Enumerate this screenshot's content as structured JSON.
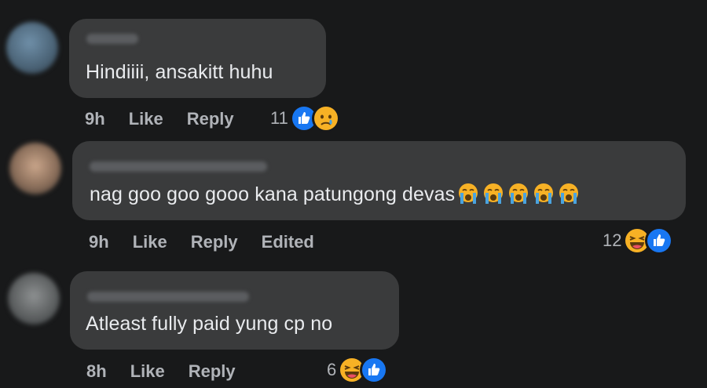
{
  "comments": [
    {
      "author": "",
      "text": "Hindiiii, ansakitt huhu",
      "time": "9h",
      "like_label": "Like",
      "reply_label": "Reply",
      "edited_label": "",
      "reaction_count": "11",
      "reactions": [
        "like-icon",
        "sad-icon"
      ]
    },
    {
      "author": "",
      "text": "nag goo goo gooo kana patungong devas",
      "time": "9h",
      "like_label": "Like",
      "reply_label": "Reply",
      "edited_label": "Edited",
      "reaction_count": "12",
      "reactions": [
        "haha-icon",
        "like-icon"
      ],
      "inline_emoji": [
        "crying-face-icon",
        "crying-face-icon",
        "crying-face-icon",
        "crying-face-icon",
        "crying-face-icon"
      ]
    },
    {
      "author": "",
      "text": "Atleast fully paid yung cp no",
      "time": "8h",
      "like_label": "Like",
      "reply_label": "Reply",
      "edited_label": "",
      "reaction_count": "6",
      "reactions": [
        "haha-icon",
        "like-icon"
      ]
    }
  ],
  "colors": {
    "background": "#18191a",
    "bubble": "#3a3b3c",
    "text": "#e9ebee",
    "meta": "#b0b3b8",
    "like_blue": "#1877f2",
    "emoji_yellow": "#f7b125"
  }
}
